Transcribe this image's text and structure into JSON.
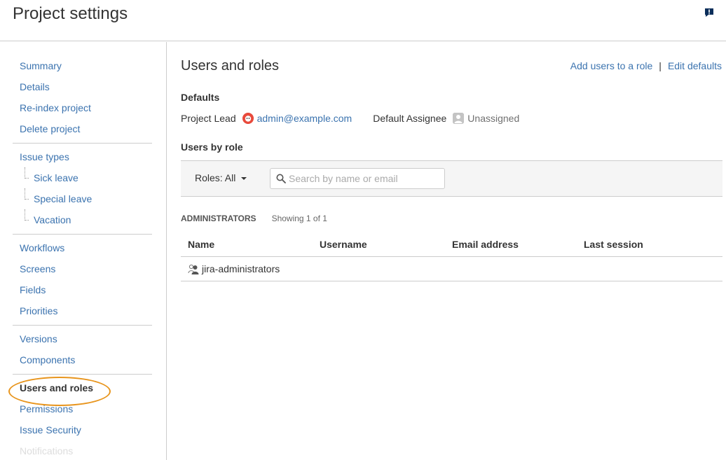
{
  "header": {
    "title": "Project settings",
    "feedback_icon": "feedback-icon"
  },
  "sidebar": {
    "groups": [
      {
        "items": [
          {
            "label": "Summary"
          },
          {
            "label": "Details"
          },
          {
            "label": "Re-index project"
          },
          {
            "label": "Delete project"
          }
        ]
      },
      {
        "items": [
          {
            "label": "Issue types"
          },
          {
            "label": "Sick leave"
          },
          {
            "label": "Special leave"
          },
          {
            "label": "Vacation"
          }
        ]
      },
      {
        "items": [
          {
            "label": "Workflows"
          },
          {
            "label": "Screens"
          },
          {
            "label": "Fields"
          },
          {
            "label": "Priorities"
          }
        ]
      },
      {
        "items": [
          {
            "label": "Versions"
          },
          {
            "label": "Components"
          }
        ]
      },
      {
        "items": [
          {
            "label": "Users and roles"
          },
          {
            "label": "Permissions"
          },
          {
            "label": "Issue Security"
          },
          {
            "label": "Notifications"
          }
        ]
      }
    ]
  },
  "main": {
    "title": "Users and roles",
    "actions": {
      "add_users": "Add users to a role",
      "separator": "|",
      "edit_defaults": "Edit defaults"
    },
    "defaults": {
      "heading": "Defaults",
      "project_lead_label": "Project Lead",
      "project_lead_value": "admin@example.com",
      "default_assignee_label": "Default Assignee",
      "default_assignee_value": "Unassigned"
    },
    "users_by_role": {
      "heading": "Users by role",
      "roles_filter": "Roles: All",
      "search_placeholder": "Search by name or email"
    },
    "role": {
      "name": "ADMINISTRATORS",
      "showing": "Showing 1 of 1",
      "columns": [
        "Name",
        "Username",
        "Email address",
        "Last session"
      ],
      "rows": [
        {
          "name": "jira-administrators",
          "username": "",
          "email": "",
          "last_session": ""
        }
      ]
    }
  },
  "colors": {
    "link": "#3b73af",
    "highlight": "#e8951d",
    "text": "#333333"
  }
}
